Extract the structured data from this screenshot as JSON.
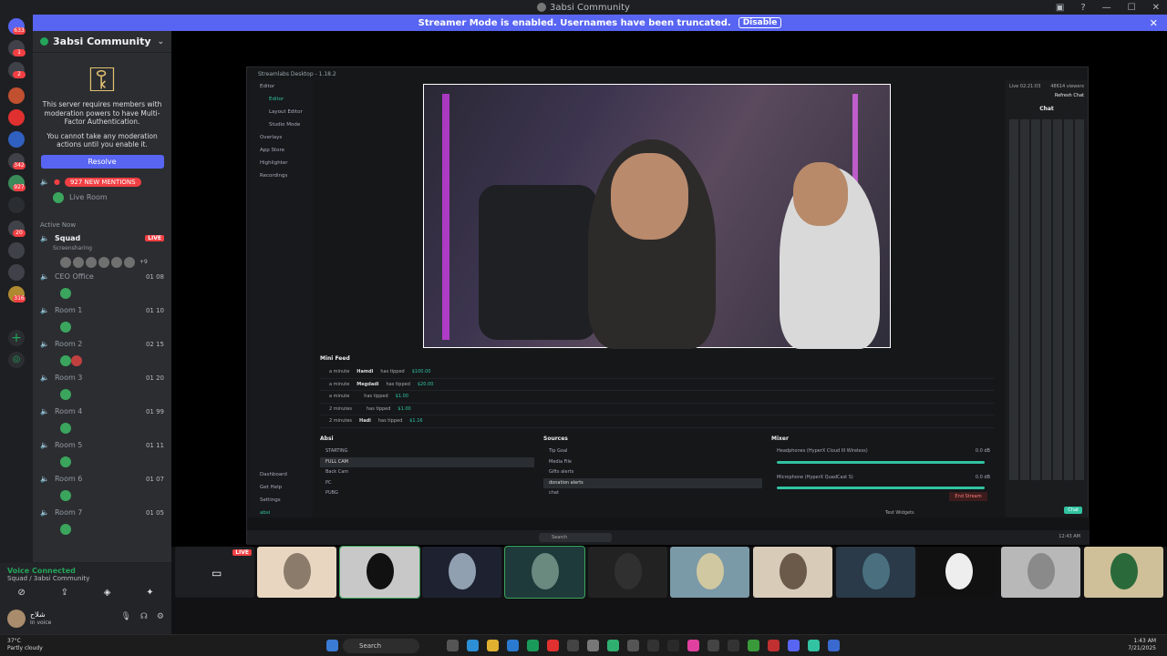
{
  "window": {
    "title": "3absi Community",
    "controls": [
      "—",
      "☐",
      "✕"
    ]
  },
  "banner": {
    "text": "Streamer Mode is enabled. Usernames have been truncated.",
    "button": "Disable",
    "close": "✕"
  },
  "servers": {
    "badges": [
      "633",
      "1",
      "2",
      "",
      "",
      "342",
      "927",
      "",
      "20",
      "316"
    ]
  },
  "guild": {
    "name": "3absi Community",
    "mfa": {
      "line1": "This server requires members with moderation powers to have Multi-Factor Authentication.",
      "line2": "You cannot take any moderation actions until you enable it.",
      "resolve": "Resolve"
    },
    "mentions": "927 NEW MENTIONS",
    "live_room": "Live Room",
    "active_now": "Active Now",
    "channels": [
      {
        "name": "Squad",
        "sub": "Screensharing",
        "badge": "LIVE",
        "extra": "+9"
      },
      {
        "name": "CEO Office",
        "count": "01 08"
      },
      {
        "name": "Room 1",
        "count": "01 10"
      },
      {
        "name": "Room 2",
        "count": "02 15"
      },
      {
        "name": "Room 3",
        "count": "01 20"
      },
      {
        "name": "Room 4",
        "count": "01 99"
      },
      {
        "name": "Room 5",
        "count": "01 11"
      },
      {
        "name": "Room 6",
        "count": "01 07"
      },
      {
        "name": "Room 7",
        "count": "01 05"
      }
    ]
  },
  "voice": {
    "status": "Voice Connected",
    "channel": "Squad / 3absi Community"
  },
  "user": {
    "name": "شلاح",
    "status": "In voice"
  },
  "streamlabs": {
    "title": "Streamlabs Desktop - 1.18.2",
    "nav": [
      "Editor",
      "Editor",
      "Layout Editor",
      "Studio Mode",
      "Overlays",
      "App Store",
      "Highlighter",
      "Recordings"
    ],
    "nav_bottom": [
      "Dashboard",
      "Get Help",
      "Settings",
      "absi"
    ],
    "minifeed_title": "Mini Feed",
    "feed": [
      {
        "time": "a minute",
        "user": "Hamdi",
        "action": "has tipped",
        "amount": "$100.00"
      },
      {
        "time": "a minute",
        "user": "Megdadi",
        "action": "has tipped",
        "amount": "$20.00"
      },
      {
        "time": "a minute",
        "user": "",
        "action": "has tipped",
        "amount": "$1.00"
      },
      {
        "time": "2 minutes",
        "user": "",
        "action": "has tipped",
        "amount": "$1.00"
      },
      {
        "time": "2 minutes",
        "user": "Hadi",
        "action": "has tipped",
        "amount": "$1.16"
      },
      {
        "time": "2 minutes",
        "user": "Subhi",
        "action": "has tipped",
        "amount": "$1.00"
      }
    ],
    "scenes_title": "Absi",
    "scenes": [
      "STARTING",
      "FULL CAM",
      "Back Cam",
      "PC",
      "PUBG"
    ],
    "sources_title": "Sources",
    "sources": [
      "Tip Goal",
      "Media File",
      "Gifts alerts",
      "donation alerts",
      "chat"
    ],
    "mixer_title": "Mixer",
    "mixer": [
      {
        "name": "Headphones (HyperX Cloud III Wireless)",
        "db": "0.0 dB"
      },
      {
        "name": "Microphone (HyperX QuadCast S)",
        "db": "0.0 dB"
      }
    ],
    "chat_title": "Chat",
    "chat_header": "Refresh Chat",
    "viewers": "48614 viewers",
    "live_time": "Live 02:21:03",
    "test_widgets": "Test Widgets",
    "end_stream": "End Stream",
    "chat_button": "Chat",
    "task_search": "Search",
    "task_time": "12:43 AM"
  },
  "tiles": {
    "live": "LIVE"
  },
  "taskbar": {
    "weather_temp": "37°C",
    "weather_desc": "Partly cloudy",
    "search": "Search",
    "time": "1:43 AM",
    "date": "7/21/2025"
  }
}
